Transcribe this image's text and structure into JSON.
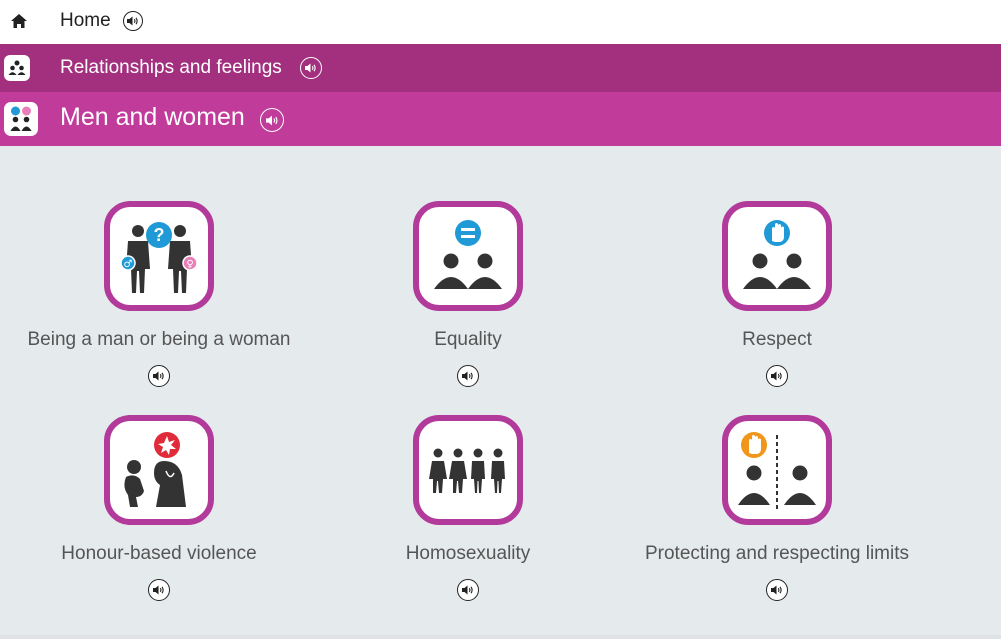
{
  "breadcrumbs": [
    {
      "label": "Home",
      "icon": "home-icon"
    },
    {
      "label": "Relationships and feelings",
      "icon": "relationships-icon"
    },
    {
      "label": "Men and women",
      "icon": "men-women-icon"
    }
  ],
  "topics": [
    {
      "label": "Being a man or being a woman",
      "icon": "man-woman-question-icon"
    },
    {
      "label": "Equality",
      "icon": "equality-icon"
    },
    {
      "label": "Respect",
      "icon": "respect-icon"
    },
    {
      "label": "Honour-based violence",
      "icon": "honour-violence-icon"
    },
    {
      "label": "Homosexuality",
      "icon": "homosexuality-icon"
    },
    {
      "label": "Protecting and respecting limits",
      "icon": "limits-icon"
    }
  ],
  "colors": {
    "home_bar": "#ffffff",
    "relationships_bar": "#a3307f",
    "men_women_bar": "#c13b9b",
    "tile_border": "#b23a9a",
    "background": "#e5eaed",
    "accent_blue": "#1f9ad6",
    "accent_pink": "#e87fb8",
    "accent_red": "#e02b3a",
    "accent_orange": "#f0961b"
  }
}
